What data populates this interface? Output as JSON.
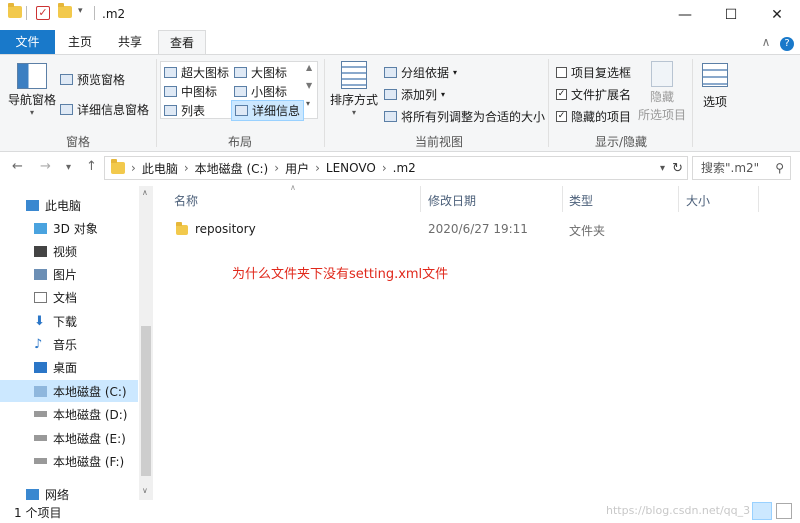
{
  "titlebar": {
    "title": ".m2",
    "minimize": "—",
    "maximize": "☐",
    "close": "✕"
  },
  "tabs": [
    "文件",
    "主页",
    "共享",
    "查看"
  ],
  "ribbon": {
    "panes": {
      "nav_pane": "导航窗格",
      "preview_pane": "预览窗格",
      "details_pane": "详细信息窗格",
      "group": "窗格"
    },
    "layout": {
      "items": [
        "超大图标",
        "大图标",
        "中图标",
        "小图标",
        "列表",
        "详细信息"
      ],
      "group": "布局"
    },
    "current_view": {
      "sort": "排序方式",
      "group_by": "分组依据",
      "add_column": "添加列",
      "fit_columns": "将所有列调整为合适的大小",
      "group": "当前视图"
    },
    "show_hide": {
      "item_checkboxes": "项目复选框",
      "file_extensions": "文件扩展名",
      "hidden_items": "隐藏的项目",
      "hide_selected_1": "隐藏",
      "hide_selected_2": "所选项目",
      "group": "显示/隐藏",
      "checked": {
        "item_checkboxes": false,
        "file_extensions": true,
        "hidden_items": true
      }
    },
    "options": "选项"
  },
  "address": {
    "crumbs": [
      "此电脑",
      "本地磁盘 (C:)",
      "用户",
      "LENOVO",
      ".m2"
    ],
    "search_placeholder": "搜索\".m2\""
  },
  "navpane": {
    "items": [
      "此电脑",
      "3D 对象",
      "视频",
      "图片",
      "文档",
      "下载",
      "音乐",
      "桌面",
      "本地磁盘 (C:)",
      "本地磁盘 (D:)",
      "本地磁盘 (E:)",
      "本地磁盘 (F:)",
      "网络"
    ],
    "selected": "本地磁盘 (C:)"
  },
  "content": {
    "columns": [
      "名称",
      "修改日期",
      "类型",
      "大小"
    ],
    "rows": [
      {
        "name": "repository",
        "modified": "2020/6/27 19:11",
        "type": "文件夹",
        "size": ""
      }
    ],
    "annotation": "为什么文件夹下没有setting.xml文件"
  },
  "status": {
    "count": "1 个项目",
    "watermark": "https://blog.csdn.net/qq_3"
  },
  "colors": {
    "accent": "#1979ca",
    "annotation": "#e0281b",
    "selected_bg": "#cce8ff"
  },
  "icons": {
    "folder": "folder-icon",
    "drive": "drive-icon",
    "network": "network-icon"
  }
}
